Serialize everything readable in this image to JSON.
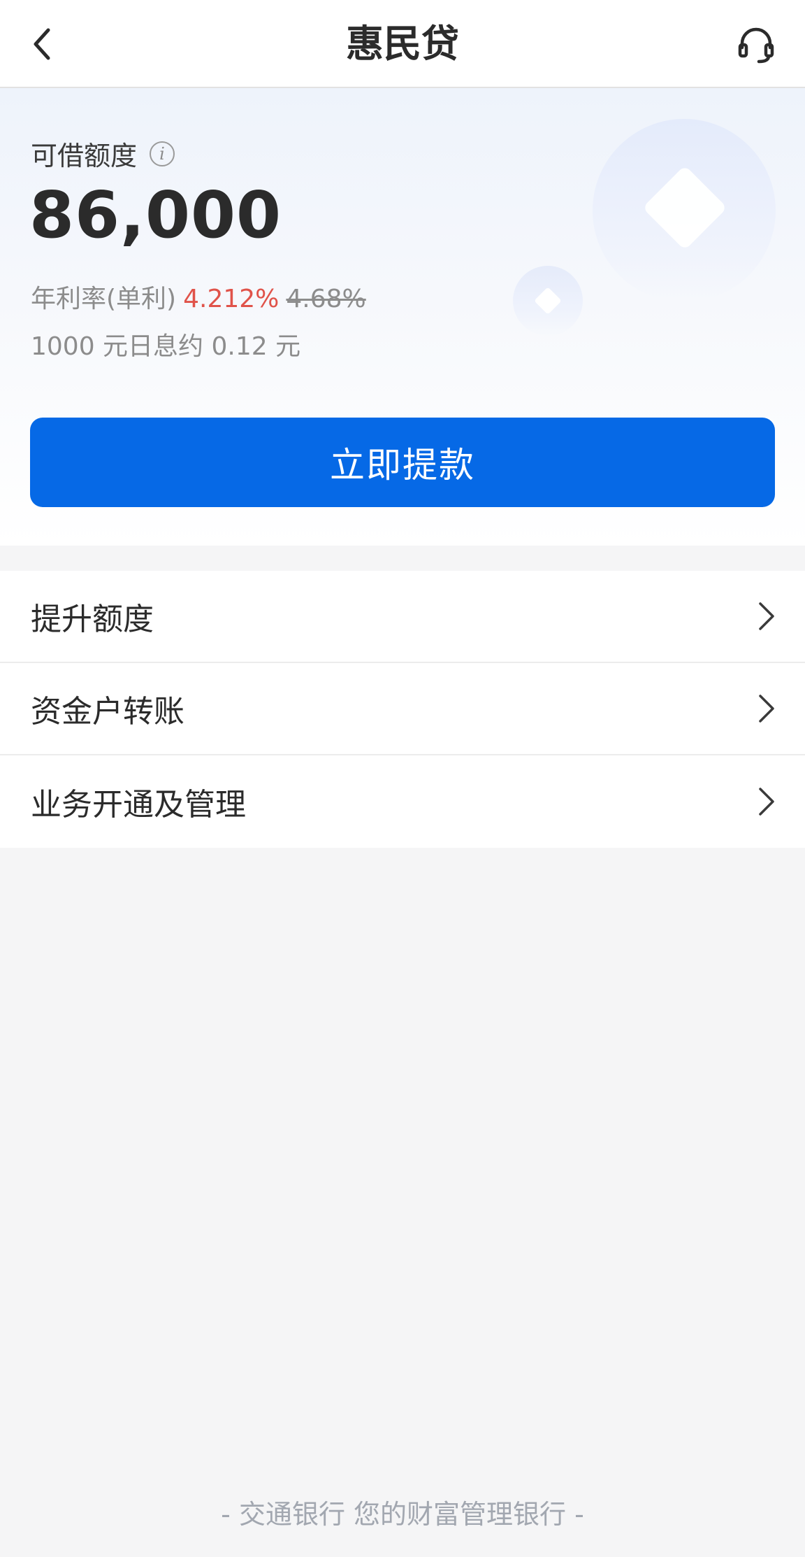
{
  "header": {
    "title": "惠民贷",
    "back_icon": "chevron-left-icon",
    "support_icon": "headset-icon"
  },
  "hero": {
    "limit_label": "可借额度",
    "info_icon_glyph": "i",
    "amount": "86,000",
    "rate_label": "年利率(单利)",
    "rate_current": "4.212%",
    "rate_original": "4.68%",
    "interest_text": "1000 元日息约 0.12 元",
    "withdraw_label": "立即提款"
  },
  "menu": {
    "items": [
      {
        "label": "提升额度"
      },
      {
        "label": "资金户转账"
      },
      {
        "label": "业务开通及管理"
      }
    ]
  },
  "footer": {
    "text": "- 交通银行 您的财富管理银行 -"
  },
  "colors": {
    "primary": "#0669e6",
    "rate_red": "#e0534a",
    "text_gray": "#8c8c8c"
  }
}
